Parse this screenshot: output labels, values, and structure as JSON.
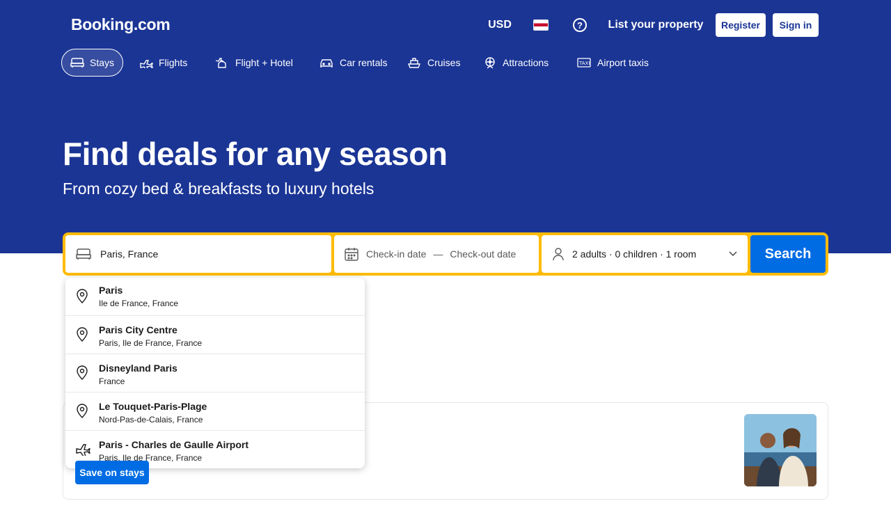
{
  "header": {
    "logo": "Booking.com",
    "currency": "USD",
    "list_property": "List your property",
    "register": "Register",
    "sign_in": "Sign in"
  },
  "nav": {
    "tabs": [
      {
        "label": "Stays",
        "icon": "bed-icon",
        "active": true
      },
      {
        "label": "Flights",
        "icon": "plane-icon"
      },
      {
        "label": "Flight + Hotel",
        "icon": "plane-hotel-icon"
      },
      {
        "label": "Car rentals",
        "icon": "car-icon"
      },
      {
        "label": "Cruises",
        "icon": "ship-icon"
      },
      {
        "label": "Attractions",
        "icon": "ferris-wheel-icon"
      },
      {
        "label": "Airport taxis",
        "icon": "taxi-icon"
      }
    ]
  },
  "hero": {
    "title": "Find deals for any season",
    "subtitle": "From cozy bed & breakfasts to luxury hotels"
  },
  "search": {
    "destination_value": "Paris, France",
    "check_in": "Check-in date",
    "separator": "—",
    "check_out": "Check-out date",
    "occupancy": "2 adults · 0 children · 1 room",
    "button": "Search"
  },
  "suggestions": [
    {
      "name": "Paris",
      "sub": "Ile de France, France",
      "icon": "pin-icon"
    },
    {
      "name": "Paris City Centre",
      "sub": "Paris, Ile de France, France",
      "icon": "pin-icon"
    },
    {
      "name": "Disneyland Paris",
      "sub": "France",
      "icon": "pin-icon"
    },
    {
      "name": "Le Touquet-Paris-Plage",
      "sub": "Nord-Pas-de-Calais, France",
      "icon": "pin-icon"
    },
    {
      "name": "Paris - Charles de Gaulle Airport",
      "sub": "Paris, Ile de France, France",
      "icon": "plane-icon"
    }
  ],
  "offers": {
    "save_button": "Save on stays"
  },
  "colors": {
    "brand_blue": "#1b3595",
    "accent_yellow": "#febb02",
    "button_blue": "#006ce4"
  }
}
